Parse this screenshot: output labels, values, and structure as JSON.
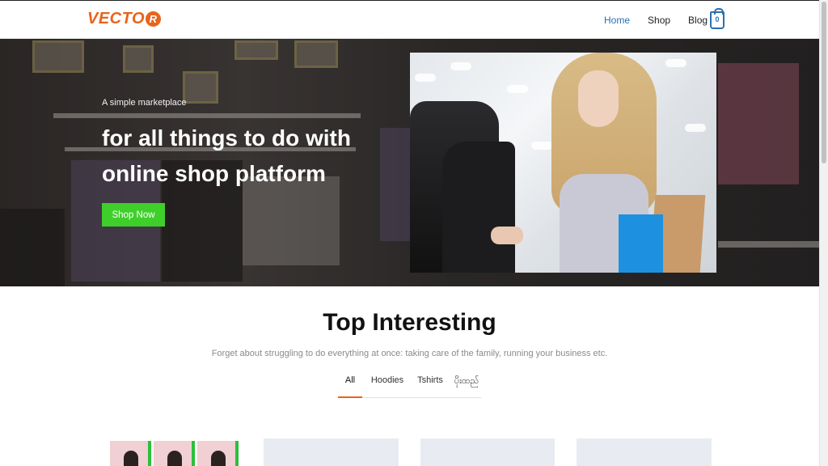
{
  "header": {
    "logo_text": "VECTO",
    "logo_badge": "R",
    "nav": [
      {
        "label": "Home",
        "active": true
      },
      {
        "label": "Shop",
        "active": false
      },
      {
        "label": "Blog",
        "active": false
      }
    ],
    "cart_count": "0",
    "cart_icon": "shopping-bag-icon"
  },
  "hero": {
    "tagline": "A simple marketplace",
    "headline_line1": "for all things to do with",
    "headline_line2": "online shop platform",
    "cta_label": "Shop Now"
  },
  "section": {
    "title": "Top Interesting",
    "subtitle": "Forget about struggling to do everything at once: taking care of the family, running your business etc.",
    "tabs": [
      {
        "label": "All",
        "active": true
      },
      {
        "label": "Hoodies",
        "active": false
      },
      {
        "label": "Tshirts",
        "active": false
      },
      {
        "label": "ပိုးထည်",
        "active": false
      }
    ]
  },
  "colors": {
    "accent": "#e8641b",
    "nav_active": "#2a6fb0",
    "cta": "#3fcf2b"
  }
}
